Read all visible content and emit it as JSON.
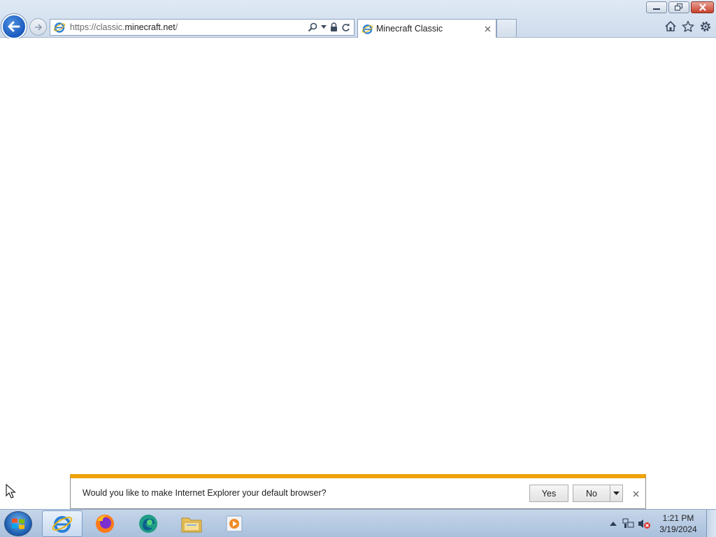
{
  "browser": {
    "address_bar": {
      "url_prefix": "https://classic.",
      "url_domain": "minecraft.net",
      "url_suffix": "/"
    },
    "tab": {
      "title": "Minecraft Classic"
    }
  },
  "notification": {
    "message": "Would you like to make Internet Explorer your default browser?",
    "yes_label": "Yes",
    "no_label": "No"
  },
  "taskbar": {
    "apps": [
      "internet-explorer",
      "firefox",
      "edge",
      "file-explorer",
      "media-player"
    ],
    "clock": {
      "time": "1:21 PM",
      "date": "3/19/2024"
    }
  },
  "colors": {
    "notification_accent": "#f0a30a",
    "back_button": "#1a5bbf",
    "close_button": "#c7402b"
  }
}
